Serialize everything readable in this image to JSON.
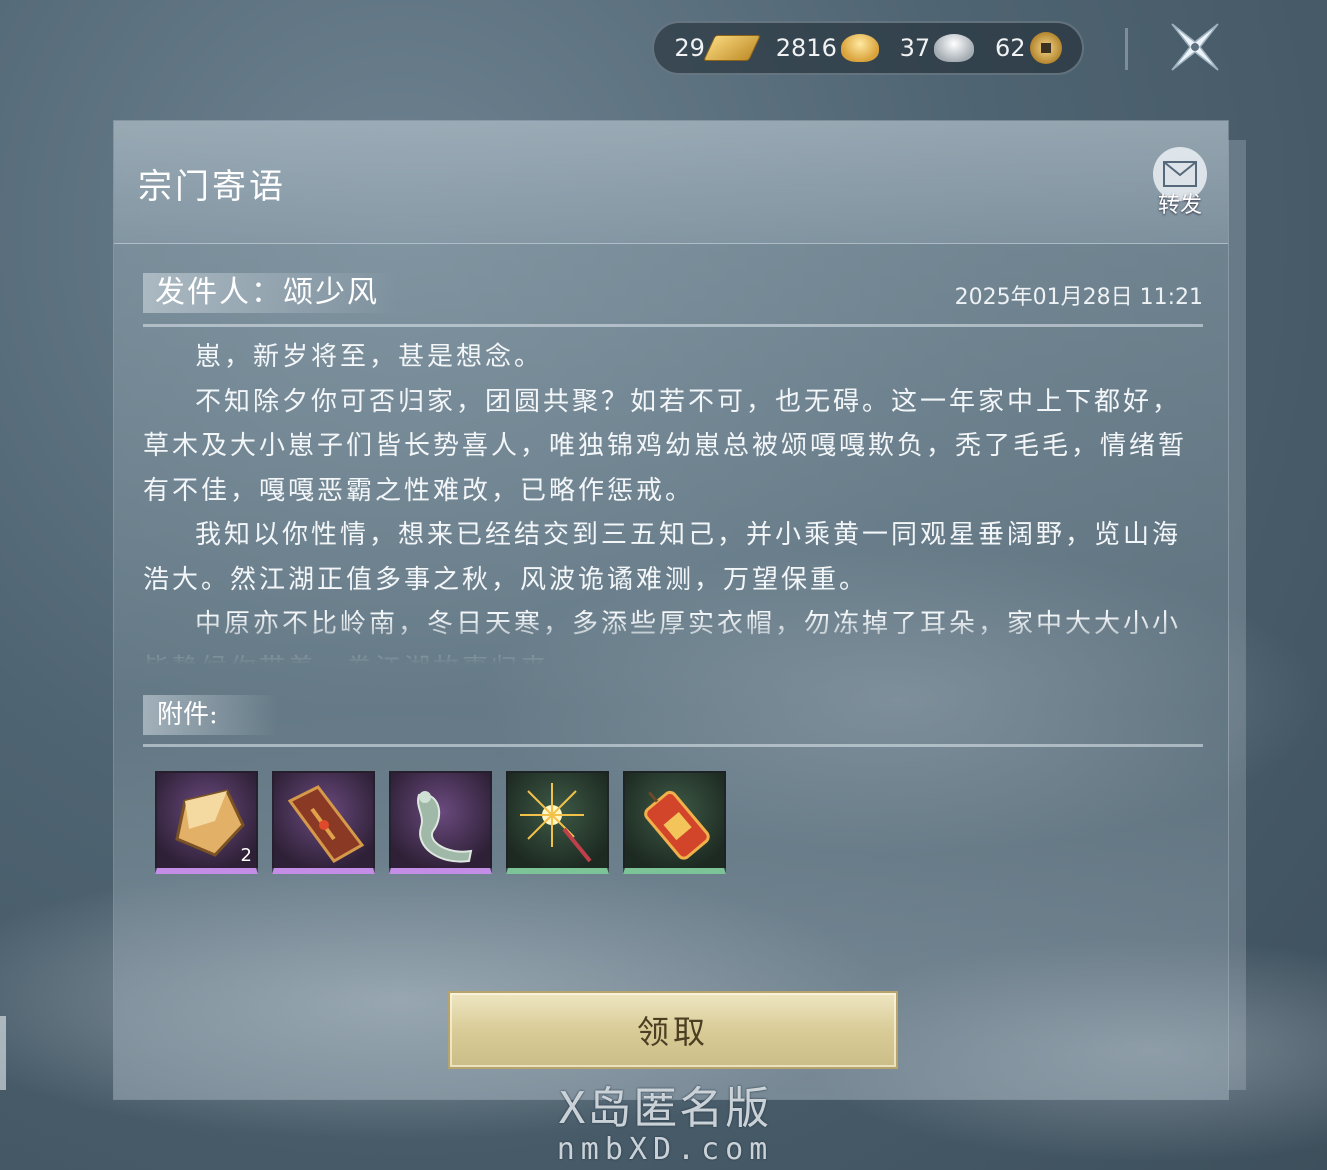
{
  "currency": [
    {
      "amount": "29",
      "icon": "gold-bar-icon"
    },
    {
      "amount": "2816",
      "icon": "gold-ingot-icon"
    },
    {
      "amount": "37",
      "icon": "silver-ingot-icon"
    },
    {
      "amount": "62",
      "icon": "copper-coin-icon"
    }
  ],
  "mail": {
    "title": "宗门寄语",
    "forward_label": "转发",
    "sender": "发件人：颂少风",
    "date": "2025年01月28日  11:21",
    "paragraphs": [
      "崽，新岁将至，甚是想念。",
      "不知除夕你可否归家，团圆共聚？如若不可，也无碍。这一年家中上下都好，草木及大小崽子们皆长势喜人，唯独锦鸡幼崽总被颂嘎嘎欺负，秃了毛毛，情绪暂有不佳，嘎嘎恶霸之性难改，已略作惩戒。",
      "我知以你性情，想来已经结交到三五知己，并小乘黄一同观星垂阔野，览山海浩大。然江湖正值多事之秋，风波诡谲难测，万望保重。",
      "中原亦不比岭南，冬日天寒，多添些厚实衣帽，勿冻掉了耳朵，家中大大小小皆静候你带着一卷江湖故事归来。"
    ],
    "attachments_label": "附件:",
    "attachments": [
      {
        "name": "golden-stone-item",
        "rarity": "purple",
        "count": "2"
      },
      {
        "name": "red-box-item",
        "rarity": "purple",
        "count": ""
      },
      {
        "name": "jade-ornament-item",
        "rarity": "purple",
        "count": ""
      },
      {
        "name": "sparkler-item",
        "rarity": "green",
        "count": ""
      },
      {
        "name": "firecracker-item",
        "rarity": "green",
        "count": ""
      }
    ],
    "claim_label": "领取"
  },
  "watermark": {
    "line1": "X岛匿名版",
    "line2": "nmbXD.com"
  }
}
